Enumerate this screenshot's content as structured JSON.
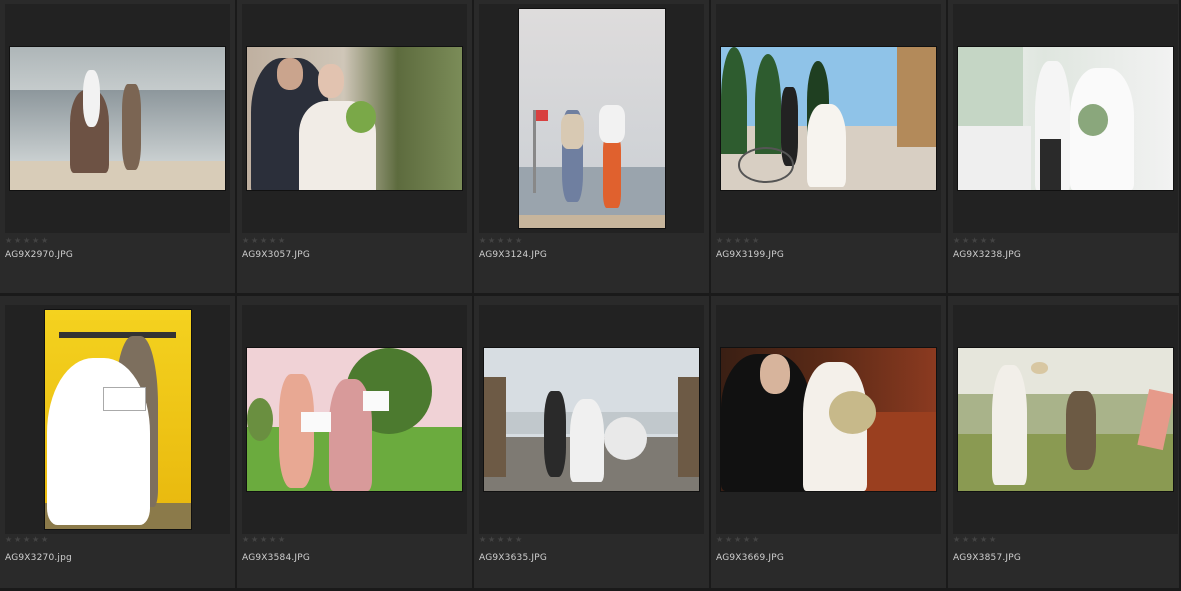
{
  "browser": {
    "items": [
      {
        "filename": "AG9X2970.JPG",
        "rating": 0,
        "orientation": "landscape",
        "scene": "beach-horse",
        "colors": [
          "#b9c2c4",
          "#8f9aa0",
          "#d8ccb8",
          "#6d5244"
        ]
      },
      {
        "filename": "AG9X3057.JPG",
        "rating": 0,
        "orientation": "landscape",
        "scene": "couple-closeup-green",
        "colors": [
          "#c6b8a5",
          "#6f7b52",
          "#2b2f3a",
          "#f1ece6"
        ]
      },
      {
        "filename": "AG9X3124.JPG",
        "rating": 0,
        "orientation": "portrait",
        "scene": "jumping-couple",
        "colors": [
          "#d9d7d7",
          "#9ca3aa",
          "#e0612e",
          "#f2f2f2"
        ]
      },
      {
        "filename": "AG9X3199.JPG",
        "rating": 0,
        "orientation": "landscape",
        "scene": "town-bicycle",
        "colors": [
          "#8fc3e8",
          "#2e5c2f",
          "#d8cfc3",
          "#b38a5a"
        ]
      },
      {
        "filename": "AG9X3238.JPG",
        "rating": 0,
        "orientation": "landscape",
        "scene": "white-chapel",
        "colors": [
          "#ededed",
          "#c7d3c8",
          "#2a2a2a",
          "#f5f5f5"
        ]
      },
      {
        "filename": "AG9X3270.jpg",
        "rating": 0,
        "orientation": "portrait",
        "scene": "yellow-backdrop",
        "colors": [
          "#f0c21b",
          "#f7e36b",
          "#7d6f5e",
          "#ffffff"
        ]
      },
      {
        "filename": "AG9X3584.JPG",
        "rating": 0,
        "orientation": "landscape",
        "scene": "park-signs",
        "colors": [
          "#f0d2d6",
          "#6bab3e",
          "#d89a9a",
          "#4c7a2f"
        ]
      },
      {
        "filename": "AG9X3635.JPG",
        "rating": 0,
        "orientation": "landscape",
        "scene": "stone-wall-seaside",
        "colors": [
          "#d7dde2",
          "#7e7a73",
          "#2a2a2a",
          "#f0f0f0"
        ]
      },
      {
        "filename": "AG9X3669.JPG",
        "rating": 0,
        "orientation": "landscape",
        "scene": "wood-interior-bouquet",
        "colors": [
          "#3a1f14",
          "#8b3a20",
          "#d7c6a5",
          "#111111"
        ]
      },
      {
        "filename": "AG9X3857.JPG",
        "rating": 0,
        "orientation": "landscape",
        "scene": "grass-proposal",
        "colors": [
          "#e6e6dc",
          "#8a9a52",
          "#6c5a44",
          "#e69a8a"
        ]
      }
    ]
  },
  "star_color": "#444444",
  "background": "#1e1e1e"
}
